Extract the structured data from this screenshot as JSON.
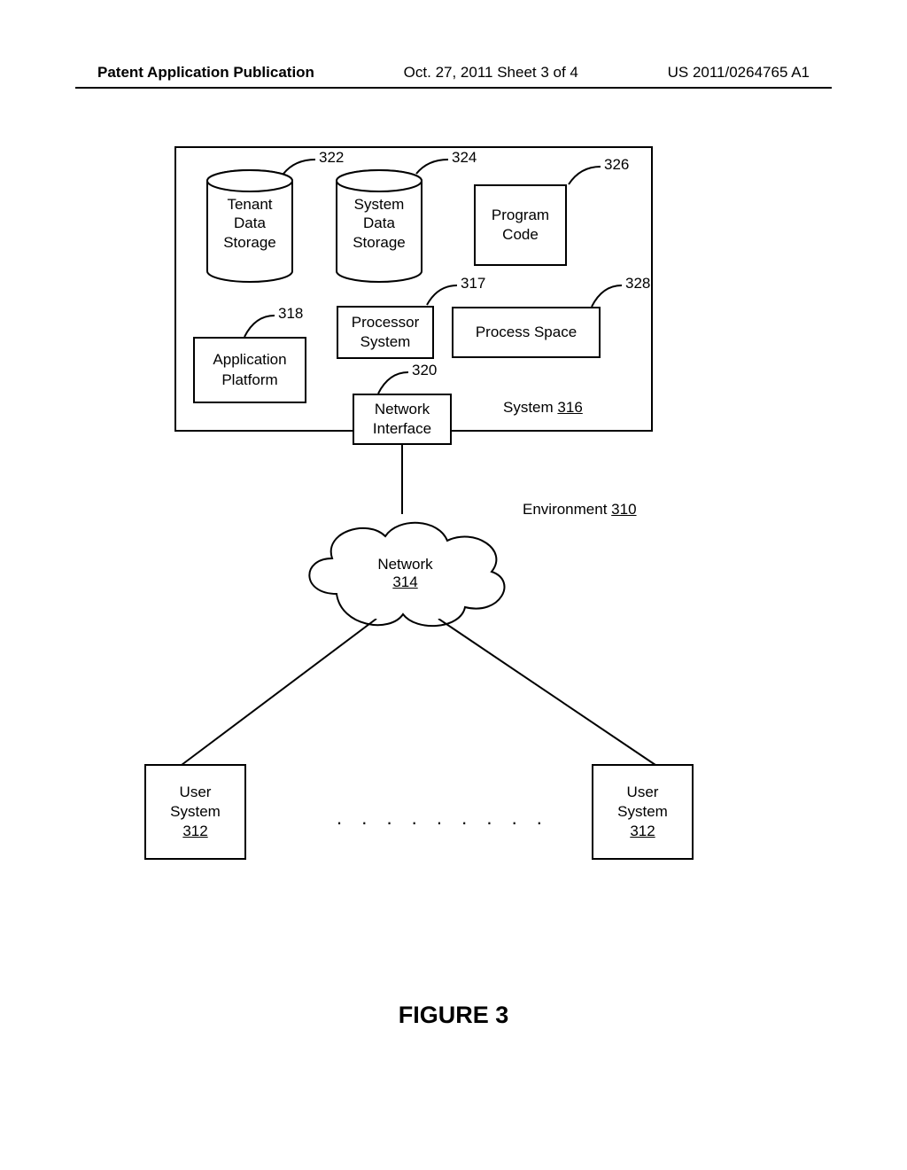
{
  "header": {
    "left": "Patent Application Publication",
    "center": "Oct. 27, 2011  Sheet 3 of 4",
    "right": "US 2011/0264765 A1"
  },
  "refs": {
    "r322": "322",
    "r324": "324",
    "r326": "326",
    "r317": "317",
    "r328": "328",
    "r318": "318",
    "r320": "320"
  },
  "blocks": {
    "tenant": [
      "Tenant",
      "Data",
      "Storage"
    ],
    "systemdata": [
      "System",
      "Data",
      "Storage"
    ],
    "program": [
      "Program",
      "Code"
    ],
    "processor": [
      "Processor",
      "System"
    ],
    "process_space": "Process Space",
    "app_platform": [
      "Application",
      "Platform"
    ],
    "net_iface": [
      "Network",
      "Interface"
    ],
    "system_label": "System",
    "system_num": "316",
    "environment": "Environment",
    "env_num": "310",
    "network": "Network",
    "network_num": "314",
    "user": [
      "User",
      "System"
    ],
    "user_num": "312",
    "dots": ". . . . . . . . ."
  },
  "figure": "FIGURE 3"
}
